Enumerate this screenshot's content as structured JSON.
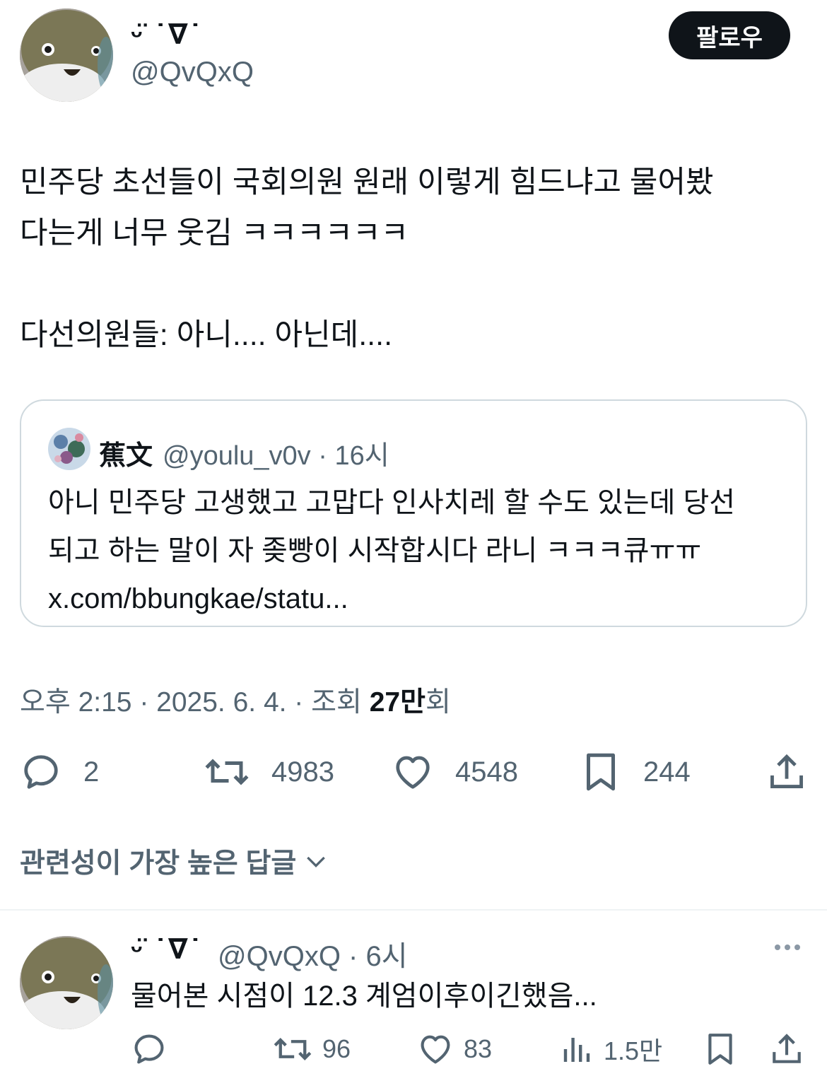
{
  "post": {
    "author": {
      "display_name": "ᵕ̈ ˙∇˙",
      "handle": "@QvQxQ",
      "avatar_icon": "seal-plush-avatar"
    },
    "follow_label": "팔로우",
    "text": "민주당 초선들이 국회의원 원래 이렇게 힘드냐고 물어봤\n다는게 너무 웃김 ㅋㅋㅋㅋㅋㅋ\n\n다선의원들: 아니.... 아닌데....",
    "quote": {
      "name": "蕉文",
      "handle_time": "@youlu_v0v · 16시",
      "text": "아니 민주당 고생했고 고맙다 인사치레 할 수도 있는데 당선\n되고 하는 말이 자 좆빵이 시작합시다 라니 ㅋㅋㅋ큐ㅠㅠ\nx.com/bbungkae/statu..."
    },
    "meta": {
      "time_date": "오후 2:15 · 2025. 6. 4. · 조회 ",
      "views_number": "27만",
      "views_suffix": "회"
    },
    "actions": {
      "replies": "2",
      "reposts": "4983",
      "likes": "4548",
      "bookmarks": "244"
    }
  },
  "replies_sort": {
    "label": "관련성이 가장 높은 답글"
  },
  "reply": {
    "display_name": "ᵕ̈ ˙∇˙",
    "handle_time": "@QvQxQ · 6시",
    "text": "물어본 시점이 12.3 계엄이후이긴했음...",
    "actions": {
      "reposts": "96",
      "likes": "83",
      "views": "1.5만"
    }
  },
  "colors": {
    "primary_text": "#0f1419",
    "secondary_text": "#536471",
    "border": "#cfd9de"
  }
}
